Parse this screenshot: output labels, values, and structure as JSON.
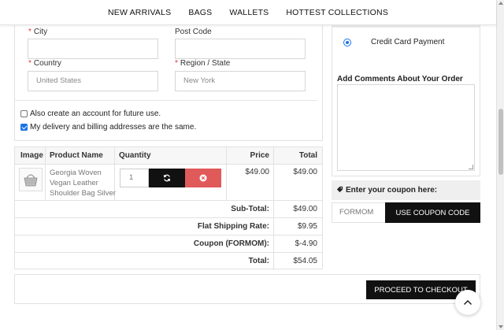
{
  "nav": {
    "items": [
      "NEW ARRIVALS",
      "BAGS",
      "WALLETS",
      "HOTTEST COLLECTIONS"
    ]
  },
  "address": {
    "city_label": "City",
    "postcode_label": "Post Code",
    "country_label": "Country",
    "country_value": "United States",
    "region_label": "Region / State",
    "region_value": "New York",
    "required_mark": "*",
    "create_account_label": "Also create an account for future use.",
    "create_account_checked": false,
    "same_address_label": "My delivery and billing addresses are the same.",
    "same_address_checked": true
  },
  "cart": {
    "headers": {
      "image": "Image",
      "name": "Product Name",
      "quantity": "Quantity",
      "price": "Price",
      "total": "Total"
    },
    "items": [
      {
        "name": "Georgia Woven Vegan Leather Shoulder Bag Silver",
        "quantity": "1",
        "price": "$49.00",
        "total": "$49.00"
      }
    ],
    "summary": [
      {
        "label": "Sub-Total:",
        "value": "$49.00"
      },
      {
        "label": "Flat Shipping Rate:",
        "value": "$9.95"
      },
      {
        "label": "Coupon (FORMOM):",
        "value": "$-4.90"
      },
      {
        "label": "Total:",
        "value": "$54.05"
      }
    ]
  },
  "payment": {
    "method_label": "Credit Card Payment",
    "comments_title": "Add Comments About Your Order"
  },
  "coupon": {
    "title": "Enter your coupon here:",
    "value": "FORMOM",
    "button_label": "USE COUPON CODE"
  },
  "checkout": {
    "button_label": "PROCEED TO CHECKOUT"
  },
  "icons": {
    "refresh": "refresh-icon",
    "remove": "times-circle-icon",
    "tag": "tag-icon",
    "chevron_up": "chevron-up-icon"
  },
  "colors": {
    "accent": "#111111",
    "danger": "#e05a5a",
    "required": "#dd3333",
    "link_blue": "#1a73e8"
  }
}
